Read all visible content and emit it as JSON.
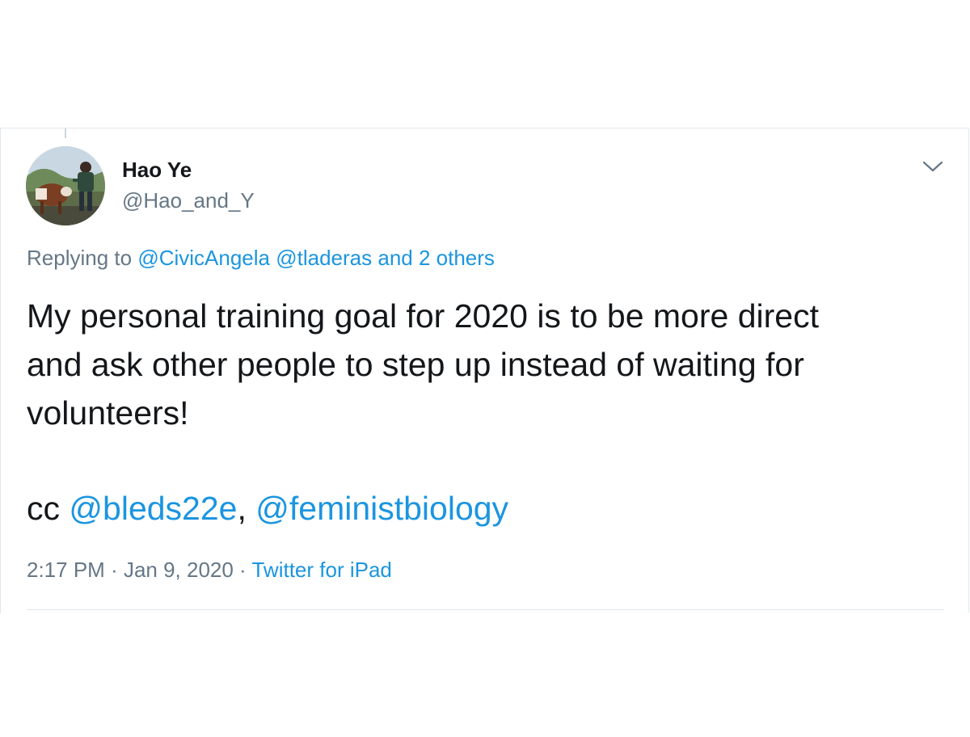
{
  "tweet": {
    "author": {
      "display_name": "Hao Ye",
      "handle": "@Hao_and_Y"
    },
    "replying_to": {
      "prefix": "Replying to ",
      "mention_1": "@CivicAngela",
      "mention_2": "@tladeras",
      "and_text": " and ",
      "others": "2 others"
    },
    "body_lines": [
      "My personal training goal for 2020 is to be more direct",
      "and ask other people to step up instead of waiting for",
      "volunteers!"
    ],
    "cc": {
      "prefix": "cc ",
      "mention_1": "@bleds22e",
      "separator": ", ",
      "mention_2": "@feministbiology"
    },
    "meta": {
      "time": "2:17 PM",
      "dot": " · ",
      "date": "Jan 9, 2020",
      "source": "Twitter for iPad"
    },
    "icons": {
      "more": "chevron-down-icon",
      "avatar": "avatar"
    },
    "colors": {
      "link": "#1b95e0",
      "secondary_text": "#657786",
      "primary_text": "#14171a",
      "border": "#e1e8ed"
    }
  }
}
